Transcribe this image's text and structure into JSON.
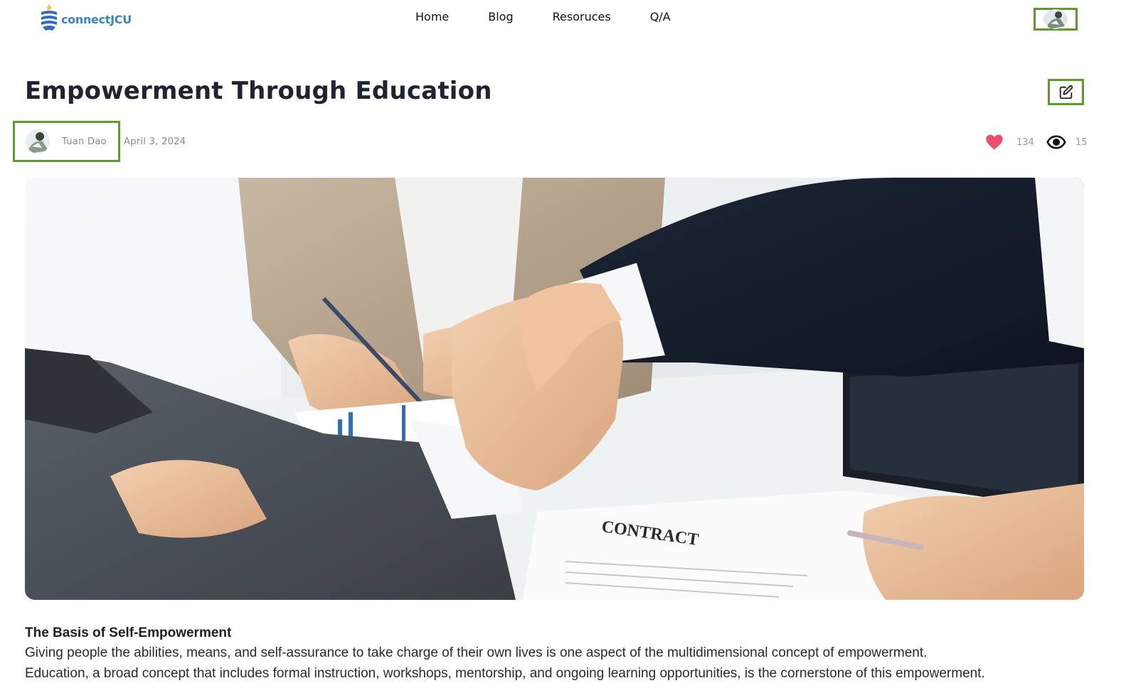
{
  "header": {
    "logo_text": "connectJCU",
    "nav": {
      "home": "Home",
      "blog": "Blog",
      "resources": "Resoruces",
      "qa": "Q/A"
    }
  },
  "post": {
    "title": "Empowerment Through Education",
    "author": "Tuan Dao",
    "date": "April 3, 2024",
    "likes": "134",
    "views": "15",
    "hero_image_text": "CONTRACT"
  },
  "article": {
    "heading": "The Basis of Self-Empowerment",
    "paragraphs": [
      "Giving people the abilities, means, and self-assurance to take charge of their own lives is one aspect of the multidimensional concept of empowerment.",
      "Education, a broad concept that includes formal instruction, workshops, mentorship, and ongoing learning opportunities, is the cornerstone of this empowerment."
    ]
  },
  "colors": {
    "highlight_border": "#5f9a2c",
    "heart": "#ee4f6e",
    "logo_blue": "#3b82c4",
    "title": "#1f2430"
  },
  "icons": [
    "logo-icon",
    "user-avatar",
    "edit-icon",
    "heart-icon",
    "eye-icon"
  ]
}
